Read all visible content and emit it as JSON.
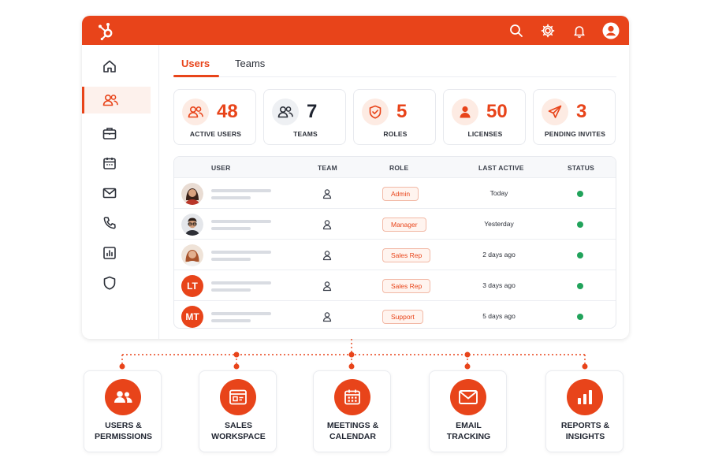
{
  "colors": {
    "accent": "#e8441a",
    "accent_soft": "#fdebe3",
    "status_active": "#21a35b"
  },
  "topbar": {
    "logo_icon": "hubspot-sprocket-icon",
    "icons": [
      "search-icon",
      "gear-icon",
      "bell-icon",
      "user-circle-icon"
    ]
  },
  "sidebar": {
    "items": [
      {
        "icon": "home-icon",
        "active": false
      },
      {
        "icon": "users-icon",
        "active": true
      },
      {
        "icon": "briefcase-icon",
        "active": false
      },
      {
        "icon": "calendar-icon",
        "active": false
      },
      {
        "icon": "mail-icon",
        "active": false
      },
      {
        "icon": "phone-icon",
        "active": false
      },
      {
        "icon": "bar-chart-icon",
        "active": false
      },
      {
        "icon": "shield-icon",
        "active": false
      }
    ]
  },
  "tabs": [
    {
      "label": "Users",
      "active": true
    },
    {
      "label": "Teams",
      "active": false
    }
  ],
  "stats": [
    {
      "value": "48",
      "label": "ACTIVE USERS",
      "icon": "users-icon"
    },
    {
      "value": "7",
      "label": "TEAMS",
      "icon": "team-icon"
    },
    {
      "value": "5",
      "label": "ROLES",
      "icon": "shield-check-icon"
    },
    {
      "value": "50",
      "label": "LICENSES",
      "icon": "person-icon"
    },
    {
      "value": "3",
      "label": "PENDING INVITES",
      "icon": "send-icon"
    }
  ],
  "table": {
    "headers": {
      "user": "USER",
      "team": "TEAM",
      "role": "ROLE",
      "last_active": "LAST ACTIVE",
      "status": "STATUS"
    },
    "rows": [
      {
        "avatar": "photo-woman-1",
        "initials": "",
        "role": "Admin",
        "last_active": "Today",
        "status": "active"
      },
      {
        "avatar": "photo-man-glasses",
        "initials": "",
        "role": "Manager",
        "last_active": "Yesterday",
        "status": "active"
      },
      {
        "avatar": "photo-woman-2",
        "initials": "",
        "role": "Sales Rep",
        "last_active": "2 days ago",
        "status": "active"
      },
      {
        "avatar": "initials",
        "initials": "LT",
        "role": "Sales Rep",
        "last_active": "3 days ago",
        "status": "active"
      },
      {
        "avatar": "initials",
        "initials": "MT",
        "role": "Support",
        "last_active": "5 days ago",
        "status": "active"
      }
    ]
  },
  "features": [
    {
      "label": "USERS &\nPERMISSIONS",
      "icon": "users-icon"
    },
    {
      "label": "SALES\nWORKSPACE",
      "icon": "sales-window-icon"
    },
    {
      "label": "MEETINGS &\nCALENDAR",
      "icon": "calendar-icon"
    },
    {
      "label": "EMAIL\nTRACKING",
      "icon": "mail-icon"
    },
    {
      "label": "REPORTS &\nINSIGHTS",
      "icon": "bar-chart-icon"
    }
  ]
}
